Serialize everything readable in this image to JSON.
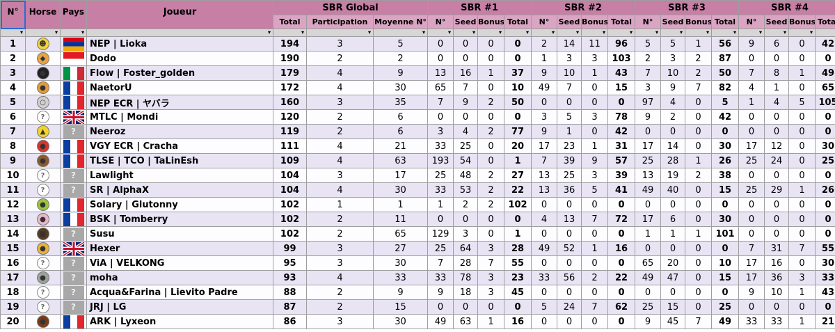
{
  "header": {
    "no": "N°",
    "horse": "Horse",
    "pays": "Pays",
    "joueur": "Joueur",
    "groups": [
      "SBR Global",
      "SBR #1",
      "SBR #2",
      "SBR #3",
      "SBR #4"
    ],
    "global_cols": [
      "Total",
      "Participation",
      "Moyenne N°"
    ],
    "event_cols": [
      "N°",
      "Seed",
      "Bonus",
      "Total"
    ]
  },
  "filter_glyph": "▾",
  "rows": [
    {
      "n": "1",
      "horse": "yellow-blue-round",
      "flag": "armenia",
      "player": "NEP | Lioka",
      "total": "194",
      "part": "3",
      "avg": "5",
      "e": [
        [
          "0",
          "0",
          "0",
          "0"
        ],
        [
          "2",
          "14",
          "11",
          "96"
        ],
        [
          "5",
          "5",
          "1",
          "56"
        ],
        [
          "9",
          "6",
          "0",
          "42"
        ]
      ]
    },
    {
      "n": "2",
      "horse": "orange-chicken",
      "flag": "indonesia",
      "player": "Dodo",
      "total": "190",
      "part": "2",
      "avg": "2",
      "e": [
        [
          "0",
          "0",
          "0",
          "0"
        ],
        [
          "1",
          "3",
          "3",
          "103"
        ],
        [
          "2",
          "3",
          "2",
          "87"
        ],
        [
          "0",
          "0",
          "0",
          "0"
        ]
      ]
    },
    {
      "n": "3",
      "horse": "black-hair",
      "flag": "italy",
      "player": "Flow | Foster_golden",
      "total": "179",
      "part": "4",
      "avg": "9",
      "e": [
        [
          "13",
          "16",
          "1",
          "37"
        ],
        [
          "9",
          "10",
          "1",
          "43"
        ],
        [
          "7",
          "10",
          "2",
          "50"
        ],
        [
          "7",
          "8",
          "1",
          "49"
        ]
      ]
    },
    {
      "n": "4",
      "horse": "orange-round",
      "flag": "france",
      "player": "NaetorU",
      "total": "172",
      "part": "4",
      "avg": "30",
      "e": [
        [
          "65",
          "7",
          "0",
          "10"
        ],
        [
          "49",
          "7",
          "0",
          "15"
        ],
        [
          "3",
          "9",
          "7",
          "82"
        ],
        [
          "4",
          "1",
          "0",
          "65"
        ]
      ]
    },
    {
      "n": "5",
      "horse": "grey-search",
      "flag": "france",
      "player": "NEP ECR | ヤバラ",
      "total": "160",
      "part": "3",
      "avg": "35",
      "e": [
        [
          "7",
          "9",
          "2",
          "50"
        ],
        [
          "0",
          "0",
          "0",
          "0"
        ],
        [
          "97",
          "4",
          "0",
          "5"
        ],
        [
          "1",
          "4",
          "5",
          "105"
        ]
      ]
    },
    {
      "n": "6",
      "horse": "question",
      "flag": "uk",
      "player": "MTLC | Mondi",
      "total": "120",
      "part": "2",
      "avg": "6",
      "e": [
        [
          "0",
          "0",
          "0",
          "0"
        ],
        [
          "3",
          "5",
          "3",
          "78"
        ],
        [
          "9",
          "2",
          "0",
          "42"
        ],
        [
          "0",
          "0",
          "0",
          "0"
        ]
      ]
    },
    {
      "n": "7",
      "horse": "pikachu",
      "flag": "unknown",
      "player": "Neeroz",
      "total": "119",
      "part": "2",
      "avg": "6",
      "e": [
        [
          "3",
          "4",
          "2",
          "77"
        ],
        [
          "9",
          "1",
          "0",
          "42"
        ],
        [
          "0",
          "0",
          "0",
          "0"
        ],
        [
          "0",
          "0",
          "0",
          "0"
        ]
      ]
    },
    {
      "n": "8",
      "horse": "red-mushroom",
      "flag": "france",
      "player": "VGY ECR | Cracha",
      "total": "111",
      "part": "4",
      "avg": "21",
      "e": [
        [
          "33",
          "25",
          "0",
          "20"
        ],
        [
          "17",
          "23",
          "1",
          "31"
        ],
        [
          "17",
          "14",
          "0",
          "30"
        ],
        [
          "17",
          "12",
          "0",
          "30"
        ]
      ]
    },
    {
      "n": "9",
      "horse": "brown-dog",
      "flag": "france",
      "player": "TLSE | TCO | TaLinEsh",
      "total": "109",
      "part": "4",
      "avg": "63",
      "e": [
        [
          "193",
          "54",
          "0",
          "1"
        ],
        [
          "7",
          "39",
          "9",
          "57"
        ],
        [
          "25",
          "28",
          "1",
          "26"
        ],
        [
          "25",
          "24",
          "0",
          "25"
        ]
      ]
    },
    {
      "n": "10",
      "horse": "question",
      "flag": "unknown",
      "player": "Lawlight",
      "total": "104",
      "part": "3",
      "avg": "17",
      "e": [
        [
          "25",
          "48",
          "2",
          "27"
        ],
        [
          "13",
          "25",
          "3",
          "39"
        ],
        [
          "13",
          "19",
          "2",
          "38"
        ],
        [
          "0",
          "0",
          "0",
          "0"
        ]
      ]
    },
    {
      "n": "11",
      "horse": "question",
      "flag": "unknown",
      "player": "SR | AlphaX",
      "total": "104",
      "part": "4",
      "avg": "30",
      "e": [
        [
          "33",
          "53",
          "2",
          "22"
        ],
        [
          "13",
          "36",
          "5",
          "41"
        ],
        [
          "49",
          "40",
          "0",
          "15"
        ],
        [
          "25",
          "29",
          "1",
          "26"
        ]
      ]
    },
    {
      "n": "12",
      "horse": "green-yellow",
      "flag": "france",
      "player": "Solary | Glutonny",
      "total": "102",
      "part": "1",
      "avg": "1",
      "e": [
        [
          "1",
          "2",
          "2",
          "102"
        ],
        [
          "0",
          "0",
          "0",
          "0"
        ],
        [
          "0",
          "0",
          "0",
          "0"
        ],
        [
          "0",
          "0",
          "0",
          "0"
        ]
      ]
    },
    {
      "n": "13",
      "horse": "pink-round",
      "flag": "france",
      "player": "BSK | Tomberry",
      "total": "102",
      "part": "2",
      "avg": "11",
      "e": [
        [
          "0",
          "0",
          "0",
          "0"
        ],
        [
          "4",
          "13",
          "7",
          "72"
        ],
        [
          "17",
          "6",
          "0",
          "30"
        ],
        [
          "0",
          "0",
          "0",
          "0"
        ]
      ]
    },
    {
      "n": "14",
      "horse": "steve",
      "flag": "unknown",
      "player": "Susu",
      "total": "102",
      "part": "2",
      "avg": "65",
      "e": [
        [
          "129",
          "3",
          "0",
          "1"
        ],
        [
          "0",
          "0",
          "0",
          "0"
        ],
        [
          "1",
          "1",
          "1",
          "101"
        ],
        [
          "0",
          "0",
          "0",
          "0"
        ]
      ]
    },
    {
      "n": "15",
      "horse": "bowser",
      "flag": "uk",
      "player": "Hexer",
      "total": "99",
      "part": "3",
      "avg": "27",
      "e": [
        [
          "25",
          "64",
          "3",
          "28"
        ],
        [
          "49",
          "52",
          "1",
          "16"
        ],
        [
          "0",
          "0",
          "0",
          "0"
        ],
        [
          "7",
          "31",
          "7",
          "55"
        ]
      ]
    },
    {
      "n": "16",
      "horse": "question",
      "flag": "unknown",
      "player": "ViA | VELKONG",
      "total": "95",
      "part": "3",
      "avg": "30",
      "e": [
        [
          "7",
          "28",
          "7",
          "55"
        ],
        [
          "0",
          "0",
          "0",
          "0"
        ],
        [
          "65",
          "20",
          "0",
          "10"
        ],
        [
          "17",
          "16",
          "0",
          "30"
        ]
      ]
    },
    {
      "n": "17",
      "horse": "alien",
      "flag": "unknown",
      "player": "moha",
      "total": "93",
      "part": "4",
      "avg": "33",
      "e": [
        [
          "33",
          "78",
          "3",
          "23"
        ],
        [
          "33",
          "56",
          "2",
          "22"
        ],
        [
          "49",
          "47",
          "0",
          "15"
        ],
        [
          "17",
          "36",
          "3",
          "33"
        ]
      ]
    },
    {
      "n": "18",
      "horse": "question",
      "flag": "unknown",
      "player": "Acqua&Farina | Lievito Padre",
      "total": "88",
      "part": "2",
      "avg": "9",
      "e": [
        [
          "9",
          "18",
          "3",
          "45"
        ],
        [
          "0",
          "0",
          "0",
          "0"
        ],
        [
          "0",
          "0",
          "0",
          "0"
        ],
        [
          "9",
          "10",
          "1",
          "43"
        ]
      ]
    },
    {
      "n": "19",
      "horse": "question",
      "flag": "unknown",
      "player": "JRJ | LG",
      "total": "87",
      "part": "2",
      "avg": "15",
      "e": [
        [
          "0",
          "0",
          "0",
          "0"
        ],
        [
          "5",
          "24",
          "7",
          "62"
        ],
        [
          "25",
          "15",
          "0",
          "25"
        ],
        [
          "0",
          "0",
          "0",
          "0"
        ]
      ]
    },
    {
      "n": "20",
      "horse": "sora",
      "flag": "france",
      "player": "ARK | Lyxeon",
      "total": "86",
      "part": "3",
      "avg": "30",
      "e": [
        [
          "49",
          "63",
          "1",
          "16"
        ],
        [
          "0",
          "0",
          "0",
          "0"
        ],
        [
          "9",
          "45",
          "7",
          "49"
        ],
        [
          "33",
          "33",
          "1",
          "21"
        ]
      ]
    }
  ],
  "unknown_flag_glyph": "?",
  "horse_glyphs": {
    "question": "?",
    "yellow-blue-round": "☻",
    "orange-chicken": "◆",
    "black-hair": "●",
    "orange-round": "●",
    "grey-search": "○",
    "pikachu": "▲",
    "red-mushroom": "●",
    "brown-dog": "●",
    "green-yellow": "●",
    "pink-round": "●",
    "steve": "■",
    "bowser": "●",
    "alien": "●",
    "sora": "●"
  },
  "horse_colors": {
    "question": "#ffffff",
    "yellow-blue-round": "#f2d23a",
    "orange-chicken": "#e9a340",
    "black-hair": "#222222",
    "orange-round": "#e39b3a",
    "grey-search": "#d0d0d0",
    "pikachu": "#f2d32c",
    "red-mushroom": "#d8342c",
    "brown-dog": "#8b5a2b",
    "green-yellow": "#9bc53d",
    "pink-round": "#e7b6c8",
    "steve": "#5a3b1e",
    "bowser": "#e6b33a",
    "alien": "#9aa39a",
    "sora": "#7a3a1a"
  }
}
